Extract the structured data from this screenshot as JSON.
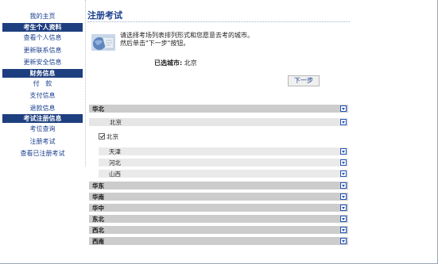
{
  "sidebar": {
    "home": "我的主页",
    "sections": [
      {
        "title": "考生个人资料",
        "items": [
          "查看个人信息",
          "更新联系信息",
          "更新安全信息"
        ]
      },
      {
        "title": "财务信息",
        "items": [
          "付   款",
          "支付信息",
          "退款信息"
        ]
      },
      {
        "title": "考试注册信息",
        "items": [
          "考位查询",
          "注册考试",
          "查看已注册考试"
        ]
      }
    ]
  },
  "main": {
    "title": "注册考试",
    "instructions": [
      "请选择考场列表排列形式和您愿意去考的城市。",
      "然后单击\"下一步\"按钮。"
    ],
    "selected_city_label": "已选城市:",
    "selected_city_value": "北京",
    "next_button": "下一步",
    "checkbox_city": "北京",
    "regions": [
      {
        "name": "华北",
        "expanded": true
      },
      {
        "name": "华东"
      },
      {
        "name": "华南"
      },
      {
        "name": "华中"
      },
      {
        "name": "东北"
      },
      {
        "name": "西北"
      },
      {
        "name": "西南"
      }
    ],
    "north_cities": [
      "北京",
      "天津",
      "河北",
      "山西"
    ]
  },
  "colors": {
    "accent": "#1e3f7f",
    "link": "#1a3f8f",
    "region_bg": "#cccccc",
    "city_bg": "#eaeaea"
  }
}
